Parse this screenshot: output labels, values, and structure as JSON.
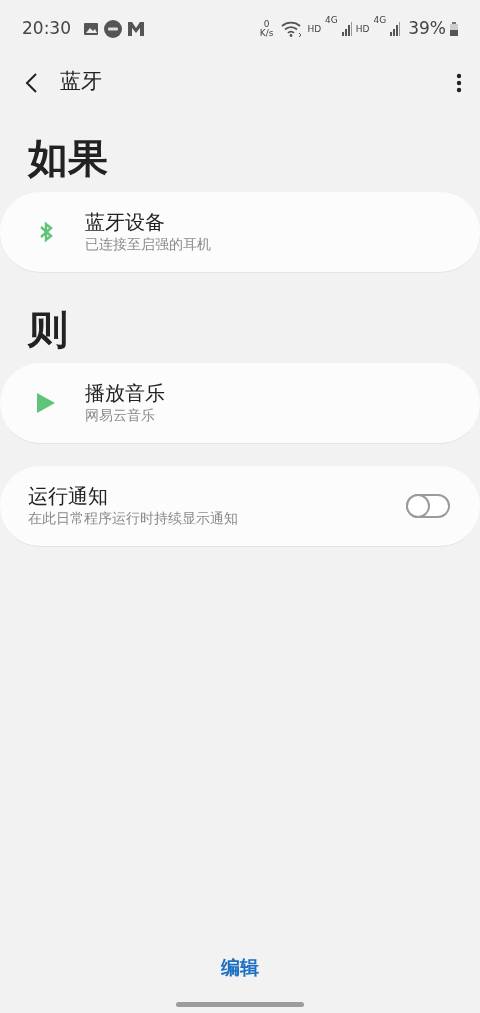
{
  "status_bar": {
    "time": "20:30",
    "net_speed_value": "0",
    "net_speed_unit": "K/s",
    "sim_1_label": "HD",
    "sim_1_network": "4G",
    "sim_2_label": "HD",
    "sim_2_network": "4G",
    "battery": "39%"
  },
  "app_bar": {
    "title": "蓝牙"
  },
  "sections": [
    {
      "heading": "如果",
      "kind": "condition",
      "items": [
        {
          "title": "蓝牙设备",
          "subtitle": "已连接至启强的耳机"
        }
      ]
    },
    {
      "heading": "则",
      "kind": "action",
      "items": [
        {
          "title": "播放音乐",
          "subtitle": "网易云音乐"
        }
      ]
    }
  ],
  "notification": {
    "title": "运行通知",
    "subtitle": "在此日常程序运行时持续显示通知",
    "on": false
  },
  "bottom_button": "编辑"
}
